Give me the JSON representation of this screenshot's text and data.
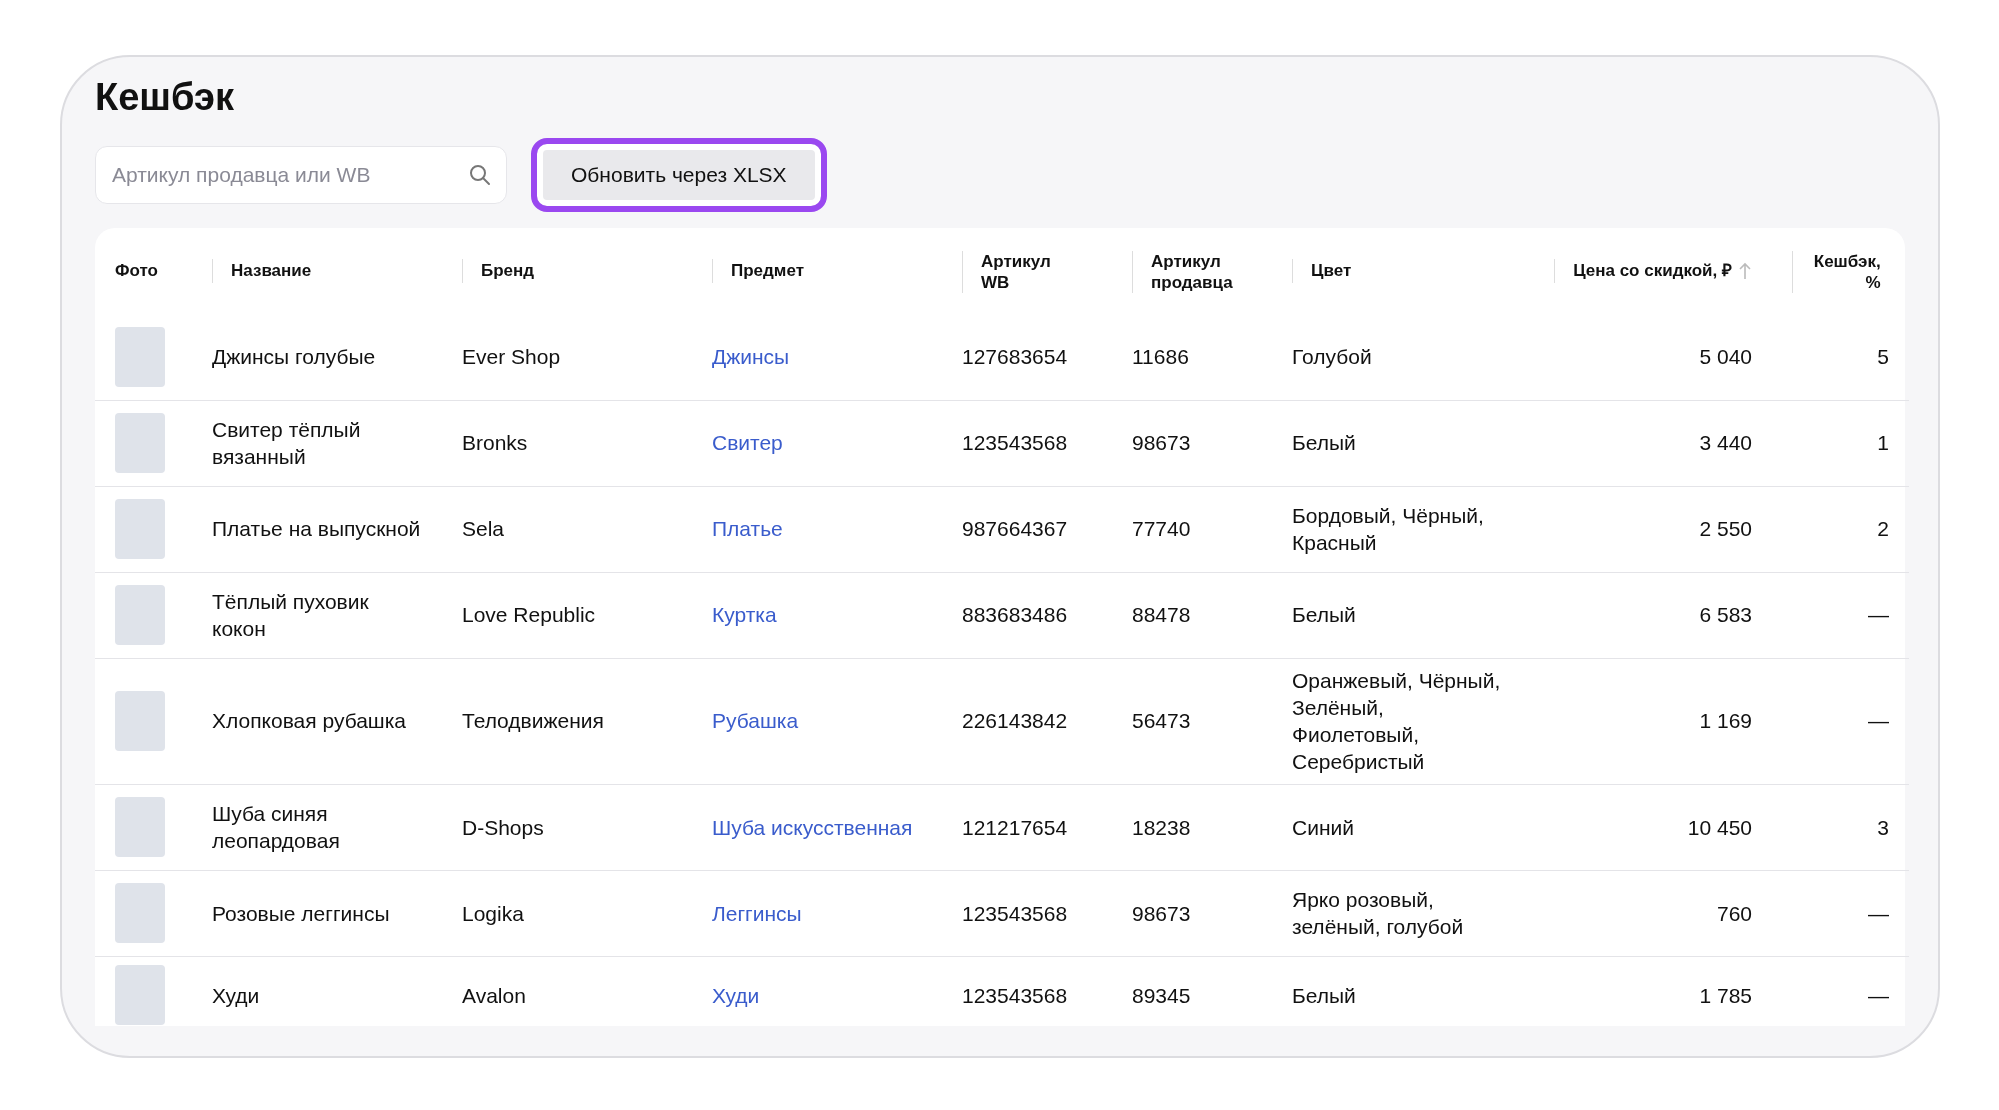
{
  "title": "Кешбэк",
  "search": {
    "placeholder": "Артикул продавца или WB"
  },
  "update_button": {
    "label": "Обновить через XLSX",
    "focused": true
  },
  "table": {
    "columns": [
      {
        "label": "Фото",
        "kind": "text",
        "sorted": false
      },
      {
        "label": "Название",
        "kind": "text",
        "sorted": false
      },
      {
        "label": "Бренд",
        "kind": "text",
        "sorted": false
      },
      {
        "label": "Предмет",
        "kind": "text",
        "sorted": false
      },
      {
        "label": "Артикул WB",
        "kind": "text",
        "sorted": false
      },
      {
        "label": "Артикул продавца",
        "kind": "text",
        "sorted": false
      },
      {
        "label": "Цвет",
        "kind": "text",
        "sorted": false
      },
      {
        "label": "Цена со скидкой, ₽",
        "kind": "number",
        "sorted": true
      },
      {
        "label": "Кешбэк, %",
        "kind": "number",
        "sorted": false
      }
    ],
    "rows": [
      {
        "name": "Джинсы голубые",
        "brand": "Ever Shop",
        "subject": "Джинсы",
        "article_wb": "127683654",
        "seller_article": "11686",
        "colour_names": "Голубой",
        "price": "5 040",
        "cashback": "5"
      },
      {
        "name": "Свитер тёплый вязанный",
        "brand": "Bronks",
        "subject": "Свитер",
        "article_wb": "123543568",
        "seller_article": "98673",
        "colour_names": "Белый",
        "price": "3 440",
        "cashback": "1"
      },
      {
        "name": "Платье на выпускной",
        "brand": "Sela",
        "subject": "Платье",
        "article_wb": "987664367",
        "seller_article": "77740",
        "colour_names": "Бордовый, Чёрный, Красный",
        "price": "2 550",
        "cashback": "2"
      },
      {
        "name": "Тёплый пуховик кокон",
        "brand": "Love Republic",
        "subject": "Куртка",
        "article_wb": "883683486",
        "seller_article": "88478",
        "colour_names": "Белый",
        "price": "6 583",
        "cashback": "—"
      },
      {
        "name": "Хлопковая рубашка",
        "brand": "Телодвижения",
        "subject": "Рубашка",
        "article_wb": "226143842",
        "seller_article": "56473",
        "colour_names": "Оранжевый, Чёрный, Зелёный, Фиолетовый, Серебристый",
        "price": "1 169",
        "cashback": "—"
      },
      {
        "name": "Шуба синяя леопардовая",
        "brand": "D-Shops",
        "subject": "Шуба искусственная",
        "article_wb": "121217654",
        "seller_article": "18238",
        "colour_names": "Синий",
        "price": "10 450",
        "cashback": "3"
      },
      {
        "name": "Розовые леггинсы",
        "brand": "Logika",
        "subject": "Леггинсы",
        "article_wb": "123543568",
        "seller_article": "98673",
        "colour_names": "Ярко розовый, зелёный, голубой",
        "price": "760",
        "cashback": "—"
      },
      {
        "name": "Худи",
        "brand": "Avalon",
        "subject": "Худи",
        "article_wb": "123543568",
        "seller_article": "89345",
        "colour_names": "Белый",
        "price": "1 785",
        "cashback": "—"
      }
    ]
  }
}
